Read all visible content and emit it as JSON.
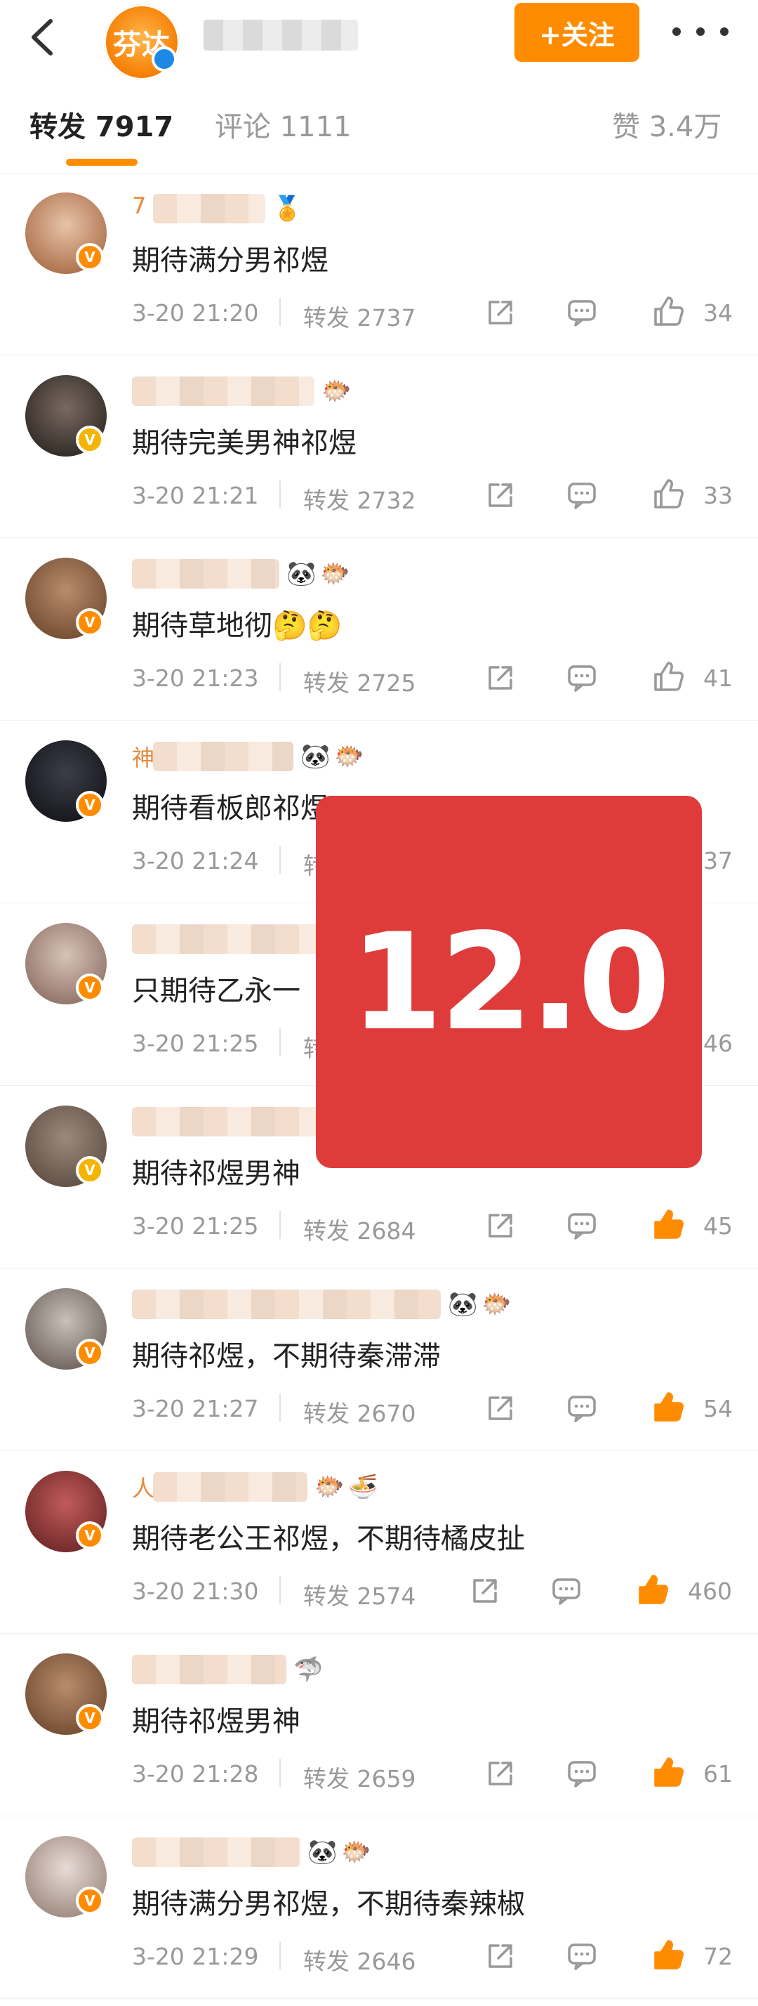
{
  "header": {
    "avatar_text": "芬达",
    "follow_label": "+关注"
  },
  "tabs": {
    "repost": "转发 7917",
    "comment": "评论 1111",
    "like": "赞 3.4万"
  },
  "comments": [
    {
      "name_prefix": "7",
      "text": "期待满分男祁煜",
      "time": "3-20 21:20",
      "repost": "转发 2737",
      "likes": "34",
      "liked": false,
      "badge": "orange",
      "emojis": [
        "🏅"
      ]
    },
    {
      "name_prefix": "",
      "text": "期待完美男神祁煜",
      "time": "3-20 21:21",
      "repost": "转发 2732",
      "likes": "33",
      "liked": false,
      "badge": "gold",
      "emojis": [
        "🐡"
      ]
    },
    {
      "name_prefix": "",
      "text": "期待草地彻🤔🤔",
      "time": "3-20 21:23",
      "repost": "转发 2725",
      "likes": "41",
      "liked": false,
      "badge": "orange",
      "emojis": [
        "🐼",
        "🐡"
      ]
    },
    {
      "name_prefix": "神",
      "text": "期待看板郎祁煜",
      "time": "3-20 21:24",
      "repost": "转发",
      "likes": "37",
      "liked": false,
      "badge": "orange",
      "emojis": [
        "🐼",
        "🐡"
      ]
    },
    {
      "name_prefix": "",
      "text": "只期待乙永一",
      "time": "3-20 21:25",
      "repost": "转",
      "likes": "46",
      "liked": false,
      "badge": "orange",
      "emojis": []
    },
    {
      "name_prefix": "",
      "text": "期待祁煜男神",
      "time": "3-20 21:25",
      "repost": "转发 2684",
      "likes": "45",
      "liked": true,
      "badge": "gold",
      "emojis": []
    },
    {
      "name_prefix": "",
      "text": "期待祁煜，不期待秦滞滞",
      "time": "3-20 21:27",
      "repost": "转发 2670",
      "likes": "54",
      "liked": true,
      "badge": "orange",
      "emojis": [
        "🐼",
        "🐡"
      ]
    },
    {
      "name_prefix": "人",
      "text": "期待老公王祁煜，不期待橘皮扯",
      "time": "3-20 21:30",
      "repost": "转发 2574",
      "likes": "460",
      "liked": true,
      "badge": "orange",
      "emojis": [
        "🐡",
        "🍜"
      ]
    },
    {
      "name_prefix": "",
      "text": "期待祁煜男神",
      "time": "3-20 21:28",
      "repost": "转发 2659",
      "likes": "61",
      "liked": true,
      "badge": "orange",
      "emojis": [
        "🦈"
      ]
    },
    {
      "name_prefix": "",
      "text": "期待满分男祁煜，不期待秦辣椒",
      "time": "3-20 21:29",
      "repost": "转发 2646",
      "likes": "72",
      "liked": true,
      "badge": "orange",
      "emojis": [
        "🐼",
        "🐡"
      ]
    }
  ],
  "overlay": {
    "score": "12.0",
    "color": "#e03b3b"
  },
  "colors": {
    "accent": "#ff8c00",
    "liked": "#ff8c00",
    "muted": "#999999"
  }
}
